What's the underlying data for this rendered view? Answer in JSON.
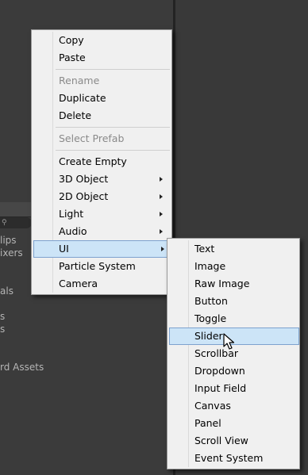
{
  "project_panel": {
    "items": [
      "lips",
      "ixers",
      "als",
      "s",
      "s",
      "rd Assets"
    ],
    "search_icon": "search-icon"
  },
  "context_menu": {
    "items": [
      {
        "label": "Copy"
      },
      {
        "label": "Paste"
      },
      {
        "label": "Rename",
        "disabled": true
      },
      {
        "label": "Duplicate"
      },
      {
        "label": "Delete"
      },
      {
        "label": "Select Prefab",
        "disabled": true
      },
      {
        "label": "Create Empty"
      },
      {
        "label": "3D Object",
        "submenu": true
      },
      {
        "label": "2D Object",
        "submenu": true
      },
      {
        "label": "Light",
        "submenu": true
      },
      {
        "label": "Audio",
        "submenu": true
      },
      {
        "label": "UI",
        "submenu": true,
        "active": true
      },
      {
        "label": "Particle System"
      },
      {
        "label": "Camera"
      }
    ]
  },
  "ui_submenu": {
    "items": [
      {
        "label": "Text"
      },
      {
        "label": "Image"
      },
      {
        "label": "Raw Image"
      },
      {
        "label": "Button"
      },
      {
        "label": "Toggle"
      },
      {
        "label": "Slider",
        "active": true
      },
      {
        "label": "Scrollbar"
      },
      {
        "label": "Dropdown"
      },
      {
        "label": "Input Field"
      },
      {
        "label": "Canvas"
      },
      {
        "label": "Panel"
      },
      {
        "label": "Scroll View"
      },
      {
        "label": "Event System"
      }
    ]
  },
  "colors": {
    "menu_background": "#f0f0f0",
    "highlight": "#cce4f7",
    "highlight_border": "#7da2ce",
    "disabled_text": "#8a8a8a",
    "editor_background": "#3b3b3b"
  },
  "cursor_icon": "mouse-pointer-icon"
}
